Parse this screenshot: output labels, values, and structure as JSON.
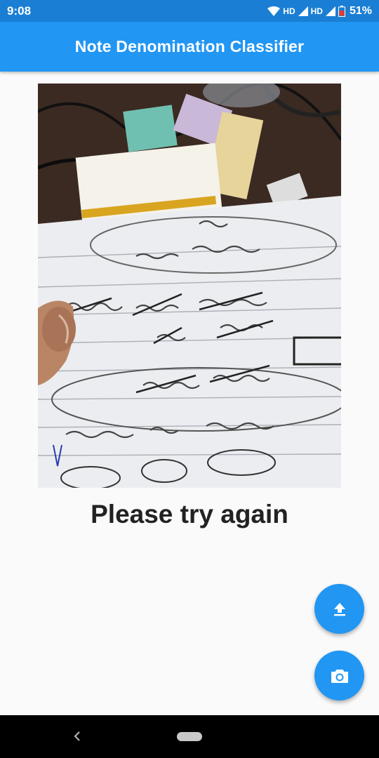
{
  "status_bar": {
    "time": "9:08",
    "network_label_1": "HD",
    "network_label_2": "HD",
    "battery": "51%"
  },
  "app_bar": {
    "title": "Note Denomination Classifier"
  },
  "photo": {
    "icon": "captured-photo-notebook-page"
  },
  "result": {
    "text": "Please try again"
  },
  "actions": {
    "upload_icon": "upload-icon",
    "camera_icon": "camera-icon"
  },
  "colors": {
    "primary": "#2196f3",
    "status_bar": "#1a7fd4",
    "background": "#fafafa"
  }
}
